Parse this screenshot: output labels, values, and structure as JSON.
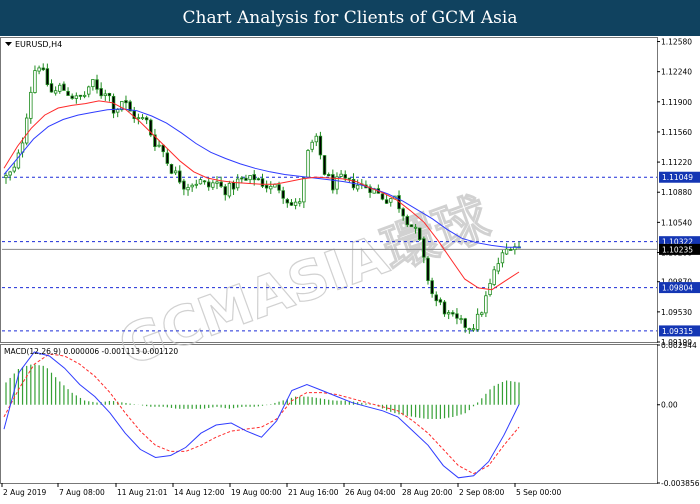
{
  "banner": {
    "title": "Chart Analysis for Clients of GCM Asia"
  },
  "watermark": {
    "text": "GCMASIA環球"
  },
  "price_panel": {
    "symbol_label": "EURUSD,H4"
  },
  "macd_panel": {
    "label": "MACD(12,26,9) 0.000006 -0.001113 0.001120"
  },
  "colors": {
    "banner_bg": "#10425f",
    "candle": "#1e8c1e",
    "ma_fast": "#ff2a2a",
    "ma_slow": "#2f3cff",
    "support_line": "#1c2cd8",
    "current_price_bg": "#000000",
    "label_bg": "#1436b4",
    "macd_hist": "#35a035",
    "macd_line": "#2f3cff",
    "signal_line": "#ff2a2a"
  },
  "chart_data": [
    {
      "type": "candlestick",
      "title": "EURUSD,H4",
      "y_ticks": [
        "1.12580",
        "1.12240",
        "1.11900",
        "1.11560",
        "1.11220",
        "1.10880",
        "1.10540",
        "1.10200",
        "1.09870",
        "1.09530",
        "1.09190"
      ],
      "y_tick_values": [
        1.1258,
        1.1224,
        1.119,
        1.1156,
        1.1122,
        1.1088,
        1.1054,
        1.102,
        1.0987,
        1.0953,
        1.0919
      ],
      "ylim": [
        1.0919,
        1.1262
      ],
      "x_ticks": [
        "2 Aug 2019",
        "7 Aug 08:00",
        "11 Aug 21:01",
        "14 Aug 12:00",
        "19 Aug 00:00",
        "21 Aug 16:00",
        "26 Aug 04:00",
        "28 Aug 20:00",
        "2 Sep 08:00",
        "5 Sep 00:00"
      ],
      "levels": [
        {
          "label": "1.11049",
          "value": 1.11049,
          "style": "dashed"
        },
        {
          "label": "1.10322",
          "value": 1.10322,
          "style": "dashed"
        },
        {
          "label": "1.09804",
          "value": 1.09804,
          "style": "dashed"
        },
        {
          "label": "1.09315",
          "value": 1.09315,
          "style": "dashed"
        }
      ],
      "current_price": {
        "label": "1.10235",
        "value": 1.10235
      },
      "close_path": [
        1.1105,
        1.1112,
        1.114,
        1.1195,
        1.1238,
        1.1216,
        1.1198,
        1.1207,
        1.12,
        1.1193,
        1.1196,
        1.1213,
        1.1198,
        1.1204,
        1.1178,
        1.1193,
        1.1178,
        1.117,
        1.117,
        1.1145,
        1.1139,
        1.1117,
        1.1107,
        1.1095,
        1.1099,
        1.11,
        1.1094,
        1.11,
        1.109,
        1.1093,
        1.1102,
        1.11,
        1.1105,
        1.1098,
        1.1092,
        1.1095,
        1.1082,
        1.107,
        1.1082,
        1.114,
        1.1146,
        1.111,
        1.1095,
        1.1103,
        1.1099,
        1.1097,
        1.1095,
        1.1093,
        1.1085,
        1.108,
        1.1082,
        1.1066,
        1.1052,
        1.104,
        1.1,
        1.0968,
        1.096,
        1.0948,
        1.0942,
        1.0938,
        1.0936,
        1.095,
        1.0975,
        1.1003,
        1.1018,
        1.103,
        1.1026
      ],
      "ma_fast_path": [
        1.1115,
        1.114,
        1.116,
        1.1175,
        1.1183,
        1.1186,
        1.1188,
        1.1191,
        1.1189,
        1.1181,
        1.1168,
        1.1153,
        1.1138,
        1.1123,
        1.1111,
        1.1104,
        1.1101,
        1.1099,
        1.1098,
        1.1097,
        1.1097,
        1.11,
        1.1103,
        1.1105,
        1.1104,
        1.1103,
        1.11,
        1.1093,
        1.1087,
        1.1079,
        1.1067,
        1.1054,
        1.1034,
        1.1012,
        1.099,
        1.098,
        1.0978,
        1.0988,
        1.0998
      ],
      "ma_slow_path": [
        1.1108,
        1.1128,
        1.1148,
        1.1162,
        1.117,
        1.1175,
        1.1178,
        1.1181,
        1.1182,
        1.118,
        1.1174,
        1.1166,
        1.1155,
        1.1143,
        1.1133,
        1.1126,
        1.112,
        1.1115,
        1.1111,
        1.1108,
        1.1106,
        1.1104,
        1.1102,
        1.11,
        1.1097,
        1.1092,
        1.1086,
        1.1078,
        1.1068,
        1.1058,
        1.1046,
        1.1036,
        1.1031,
        1.1028,
        1.1026,
        1.1026
      ]
    },
    {
      "type": "bar",
      "title": "MACD(12,26,9)",
      "values_label": "0.000006 -0.001113 0.001120",
      "y_ticks": [
        "0.002944",
        "0.00",
        "-0.003856"
      ],
      "y_tick_values": [
        0.002944,
        0,
        -0.003856
      ],
      "ylim": [
        -0.003856,
        0.002944
      ],
      "histogram_path": [
        0.0011,
        0.0018,
        0.002,
        0.0019,
        0.0012,
        0.0006,
        0.0002,
        0.0001,
        0.0002,
        0.0001,
        0.0,
        -0.0001,
        -0.0001,
        -0.0002,
        -0.0002,
        -0.0002,
        -0.0001,
        -0.0002,
        -0.0001,
        -0.0001,
        0.0,
        0.0002,
        0.0004,
        0.0004,
        0.0003,
        0.0002,
        0.0002,
        0.0001,
        0.0,
        -0.0003,
        -0.0005,
        -0.0006,
        -0.0007,
        -0.0007,
        -0.0006,
        -0.0004,
        0.0002,
        0.0009,
        0.0012,
        0.0011
      ],
      "macd_path": [
        -0.0012,
        0.0016,
        0.0026,
        0.0024,
        0.0018,
        0.001,
        0.0004,
        -0.0004,
        -0.0014,
        -0.0022,
        -0.0026,
        -0.0025,
        -0.0021,
        -0.0014,
        -0.001,
        -0.0009,
        -0.0013,
        -0.0016,
        -0.0008,
        0.0007,
        0.001,
        0.0007,
        0.0004,
        0.0001,
        -0.0001,
        -0.0003,
        -0.0006,
        -0.0013,
        -0.002,
        -0.003,
        -0.0036,
        -0.0035,
        -0.0028,
        -0.0015,
        1e-05
      ],
      "signal_path": [
        -0.0006,
        0.0008,
        0.002,
        0.0025,
        0.0024,
        0.002,
        0.0014,
        0.0006,
        -0.0004,
        -0.0013,
        -0.002,
        -0.0023,
        -0.0023,
        -0.002,
        -0.0016,
        -0.0013,
        -0.0012,
        -0.0011,
        -0.0007,
        0.0002,
        0.0006,
        0.0006,
        0.0005,
        0.0003,
        0.0001,
        -0.0001,
        -0.0003,
        -0.0008,
        -0.0014,
        -0.0022,
        -0.003,
        -0.0034,
        -0.003,
        -0.002,
        -0.0011
      ]
    }
  ]
}
